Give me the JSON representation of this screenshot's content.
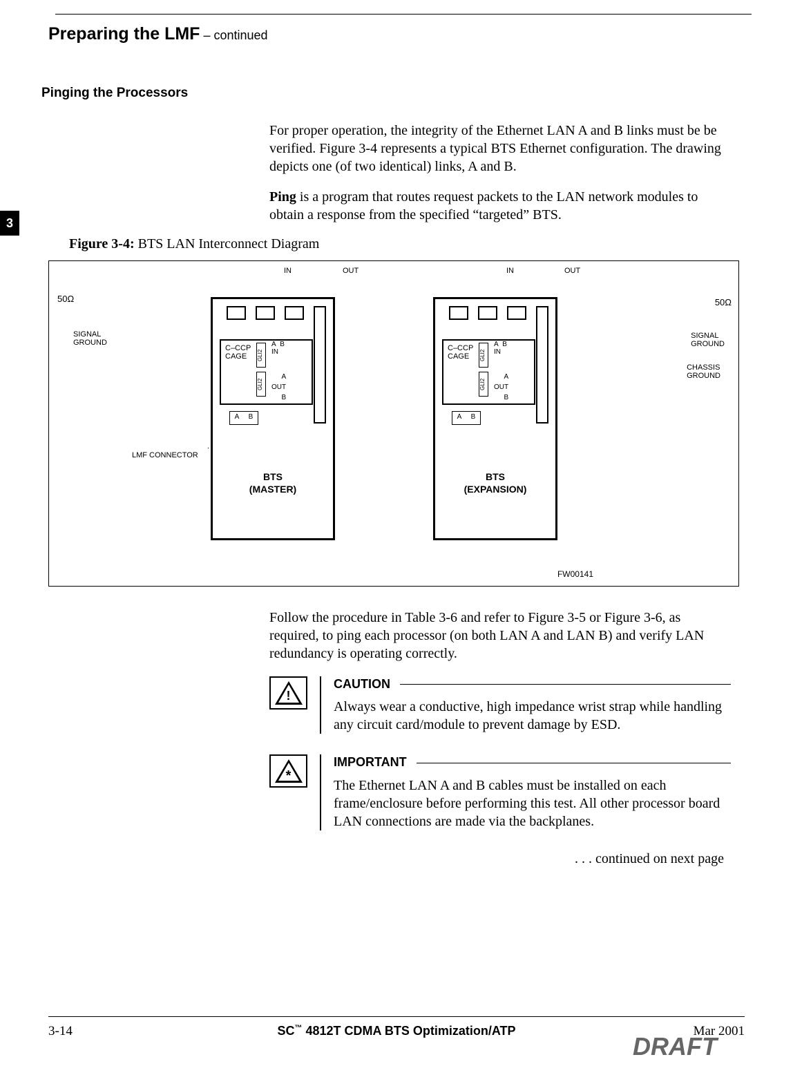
{
  "header": {
    "title": "Preparing the LMF",
    "suffix": " – continued"
  },
  "sideTab": "3",
  "subsection": "Pinging the Processors",
  "para1": "For proper operation, the integrity of the Ethernet LAN A and B links must be be verified. Figure 3-4 represents a typical BTS Ethernet configuration. The drawing depicts one (of two identical) links, A and B.",
  "para2_lead": "Ping",
  "para2_rest": " is a program that routes request packets to the LAN network modules to obtain a response from the specified “targeted” BTS.",
  "figure": {
    "label": "Figure 3-4:",
    "caption": " BTS LAN Interconnect Diagram",
    "code": "FW00141",
    "labels": {
      "in": "IN",
      "out": "OUT",
      "signalGround": "SIGNAL\nGROUND",
      "chassisGround": "CHASSIS\nGROUND",
      "ohm": "50Ω",
      "ccp": "C–CCP\nCAGE",
      "gli": "GLI2",
      "a": "A",
      "b": "B",
      "lmf": "LMF CONNECTOR",
      "btsMaster": "BTS\n(MASTER)",
      "btsExp": "BTS\n(EXPANSION)"
    }
  },
  "para3": "Follow the procedure in Table 3-6 and refer to Figure 3-5 or Figure 3-6, as required, to ping each processor (on both LAN A and LAN B) and verify LAN redundancy is operating correctly.",
  "caution": {
    "title": "CAUTION",
    "body": "Always wear a conductive, high impedance wrist strap while handling any circuit card/module to prevent damage by ESD."
  },
  "important": {
    "title": "IMPORTANT",
    "body": "The Ethernet LAN A and B cables must be installed on each frame/enclosure before performing this test. All other processor board LAN connections are made via the backplanes."
  },
  "continued": ". . . continued on next page",
  "footer": {
    "pageNum": "3-14",
    "centerPre": "SC",
    "centerPost": "4812T CDMA BTS Optimization/ATP",
    "tm": "™",
    "date": "Mar 2001",
    "draft": "DRAFT"
  }
}
